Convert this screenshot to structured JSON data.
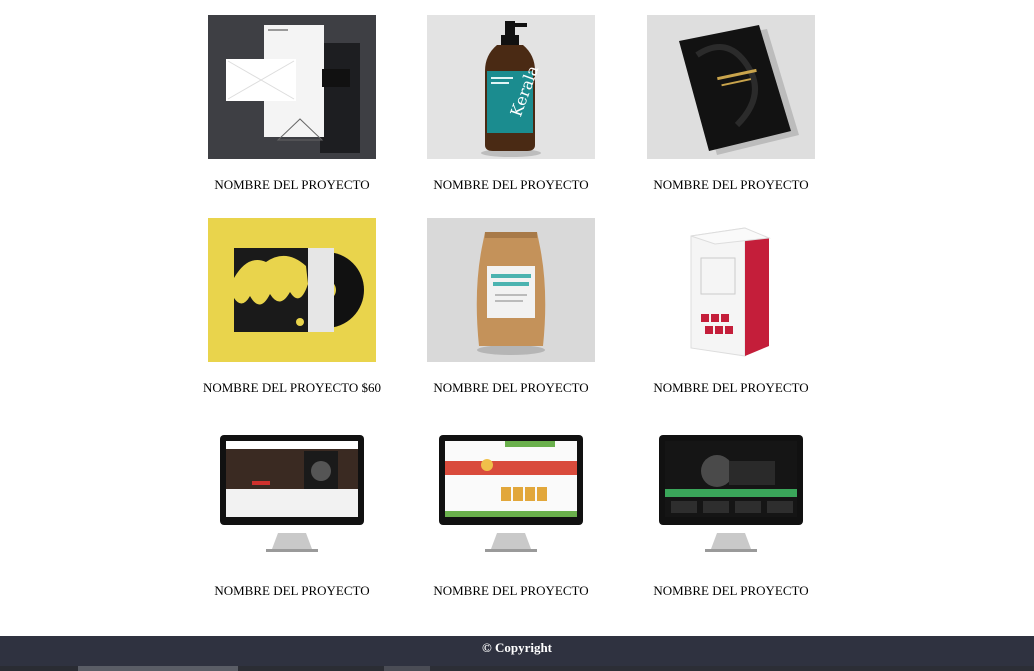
{
  "projects": [
    {
      "title": "NOMBRE DEL PROYECTO",
      "image": "stationery-mockup"
    },
    {
      "title": "NOMBRE DEL PROYECTO",
      "image": "kerala-bottle-mockup"
    },
    {
      "title": "NOMBRE DEL PROYECTO",
      "image": "black-book-mockup"
    },
    {
      "title": "NOMBRE DEL PROYECTO $60",
      "image": "vinyl-record-mockup"
    },
    {
      "title": "NOMBRE DEL PROYECTO",
      "image": "coffee-pouch-mockup"
    },
    {
      "title": "NOMBRE DEL PROYECTO",
      "image": "product-box-mockup"
    },
    {
      "title": "NOMBRE DEL PROYECTO",
      "image": "website-monitor-speakers"
    },
    {
      "title": "NOMBRE DEL PROYECTO",
      "image": "website-monitor-shop"
    },
    {
      "title": "NOMBRE DEL PROYECTO",
      "image": "website-monitor-dark"
    }
  ],
  "footer": {
    "copyright": "© Copyright"
  },
  "colors": {
    "footer_bg": "#2f3240",
    "bottle_teal": "#1b8c8f",
    "vinyl_yellow": "#e9d44c",
    "box_red": "#c41e3a"
  }
}
